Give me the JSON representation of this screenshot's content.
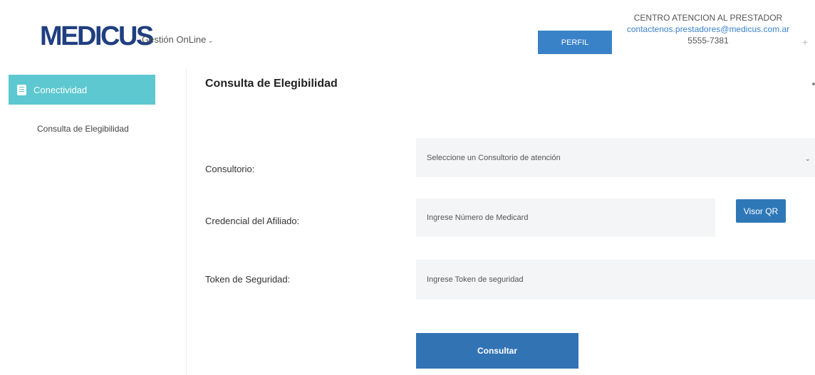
{
  "header": {
    "logo": "MEDICUS",
    "product_menu": "Gestión OnLine",
    "profile_button": "PERFIL",
    "contact": {
      "title": "CENTRO ATENCION AL PRESTADOR",
      "email": "contactenos.prestadores@medicus.com.ar",
      "phone": "5555-7381"
    },
    "expand_icon": "plus-icon"
  },
  "sidebar": {
    "section": {
      "label": "Conectividad",
      "icon": "book-icon"
    },
    "items": [
      {
        "label": "Consulta de Elegibilidad"
      }
    ]
  },
  "main": {
    "title": "Consulta de Elegibilidad",
    "form": {
      "consultorio": {
        "label": "Consultorio:",
        "selected": "Seleccione un Consultorio de atención"
      },
      "credencial": {
        "label": "Credencial del Afiliado:",
        "placeholder": "Ingrese Número de Medicard",
        "qr_button": "Visor QR"
      },
      "token": {
        "label": "Token de Seguridad:",
        "placeholder": "Ingrese Token de seguridad"
      },
      "submit": "Consultar"
    }
  },
  "colors": {
    "brand": "#1f3f80",
    "accent": "#3a82c8",
    "sidebar_active": "#5dc8cf",
    "button": "#3273b4"
  }
}
